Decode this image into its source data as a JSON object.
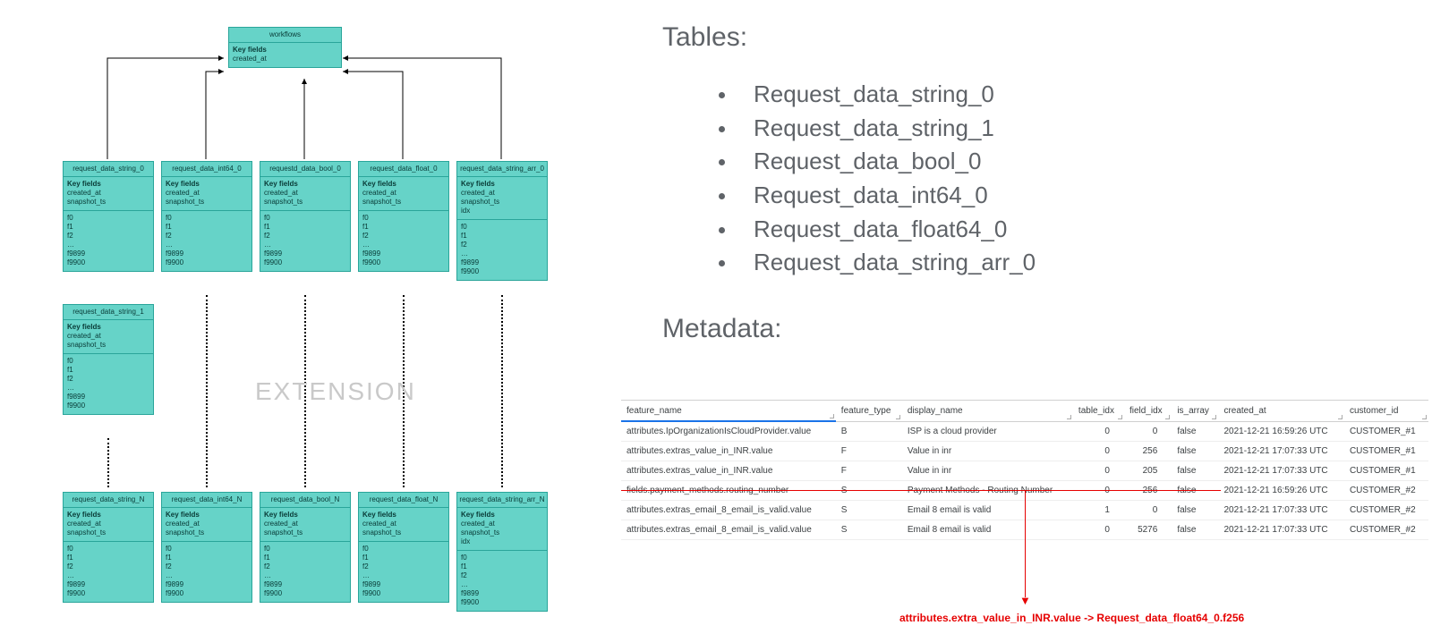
{
  "erd": {
    "root": {
      "title": "workflows",
      "key_label": "Key fields",
      "keys": [
        "created_at"
      ]
    },
    "extension_label": "EXTENSION",
    "box_key_label": "Key fields",
    "box_keys": "created_at\nsnapshot_ts",
    "box_keys_idx": "created_at\nsnapshot_ts\nidx",
    "box_fields": "f0\nf1\nf2\n…\nf9899\nf9900",
    "row1": [
      {
        "title": "request_data_string_0",
        "idx": false
      },
      {
        "title": "request_data_int64_0",
        "idx": false
      },
      {
        "title": "requestd_data_bool_0",
        "idx": false
      },
      {
        "title": "request_data_float_0",
        "idx": false
      },
      {
        "title": "request_data_string_arr_0",
        "idx": true
      }
    ],
    "sidebox": {
      "title": "request_data_string_1",
      "idx": false
    },
    "rowN": [
      {
        "title": "request_data_string_N",
        "idx": false
      },
      {
        "title": "request_data_int64_N",
        "idx": false
      },
      {
        "title": "request_data_bool_N",
        "idx": false
      },
      {
        "title": "request_data_float_N",
        "idx": false
      },
      {
        "title": "request_data_string_arr_N",
        "idx": true
      }
    ]
  },
  "rhs": {
    "tables_header": "Tables:",
    "tables": [
      "Request_data_string_0",
      "Request_data_string_1",
      "Request_data_bool_0",
      "Request_data_int64_0",
      "Request_data_float64_0",
      "Request_data_string_arr_0"
    ],
    "metadata_header": "Metadata:"
  },
  "meta": {
    "columns": [
      "feature_name",
      "feature_type",
      "display_name",
      "table_idx",
      "field_idx",
      "is_array",
      "created_at",
      "customer_id"
    ],
    "rows": [
      {
        "feature_name": "attributes.IpOrganizationIsCloudProvider.value",
        "feature_type": "B",
        "display_name": "ISP is a cloud provider",
        "table_idx": "0",
        "field_idx": "0",
        "is_array": "false",
        "created_at": "2021-12-21 16:59:26 UTC",
        "customer_id": "CUSTOMER_#1"
      },
      {
        "feature_name": "attributes.extras_value_in_INR.value",
        "feature_type": "F",
        "display_name": "Value in inr",
        "table_idx": "0",
        "field_idx": "256",
        "is_array": "false",
        "created_at": "2021-12-21 17:07:33 UTC",
        "customer_id": "CUSTOMER_#1"
      },
      {
        "feature_name": "attributes.extras_value_in_INR.value",
        "feature_type": "F",
        "display_name": "Value in inr",
        "table_idx": "0",
        "field_idx": "205",
        "is_array": "false",
        "created_at": "2021-12-21 17:07:33 UTC",
        "customer_id": "CUSTOMER_#1"
      },
      {
        "feature_name": "fields.payment_methods.routing_number",
        "feature_type": "S",
        "display_name": "Payment Methods - Routing Number",
        "table_idx": "0",
        "field_idx": "256",
        "is_array": "false",
        "created_at": "2021-12-21 16:59:26 UTC",
        "customer_id": "CUSTOMER_#2"
      },
      {
        "feature_name": "attributes.extras_email_8_email_is_valid.value",
        "feature_type": "S",
        "display_name": "Email 8 email is valid",
        "table_idx": "1",
        "field_idx": "0",
        "is_array": "false",
        "created_at": "2021-12-21 17:07:33 UTC",
        "customer_id": "CUSTOMER_#2"
      },
      {
        "feature_name": "attributes.extras_email_8_email_is_valid.value",
        "feature_type": "S",
        "display_name": "Email 8 email is valid",
        "table_idx": "0",
        "field_idx": "5276",
        "is_array": "false",
        "created_at": "2021-12-21 17:07:33 UTC",
        "customer_id": "CUSTOMER_#2"
      }
    ],
    "highlight_row": 1,
    "annotation": "attributes.extra_value_in_INR.value -> Request_data_float64_0.f256"
  }
}
